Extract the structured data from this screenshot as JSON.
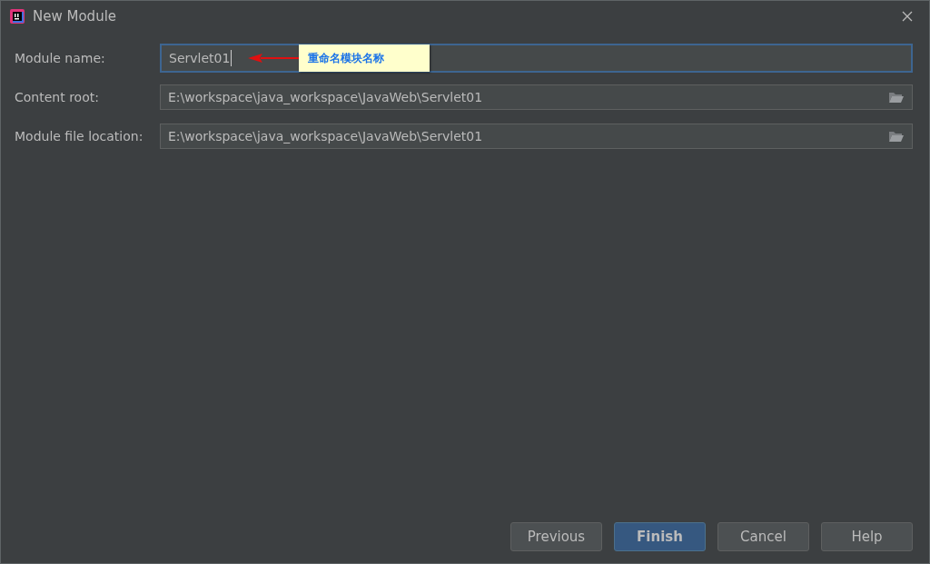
{
  "window": {
    "title": "New Module"
  },
  "fields": [
    {
      "label": "Module name:",
      "value": "Servlet01",
      "focused": true,
      "kind": "text"
    },
    {
      "label": "Content root:",
      "value": "E:\\workspace\\java_workspace\\JavaWeb\\Servlet01",
      "focused": false,
      "kind": "path"
    },
    {
      "label": "Module file location:",
      "value": "E:\\workspace\\java_workspace\\JavaWeb\\Servlet01",
      "focused": false,
      "kind": "path"
    }
  ],
  "annotation": {
    "text": "重命名模块名称"
  },
  "buttons": [
    {
      "label": "Previous",
      "kind": "normal"
    },
    {
      "label": "Finish",
      "kind": "primary"
    },
    {
      "label": "Cancel",
      "kind": "normal"
    },
    {
      "label": "Help",
      "kind": "normal"
    }
  ]
}
